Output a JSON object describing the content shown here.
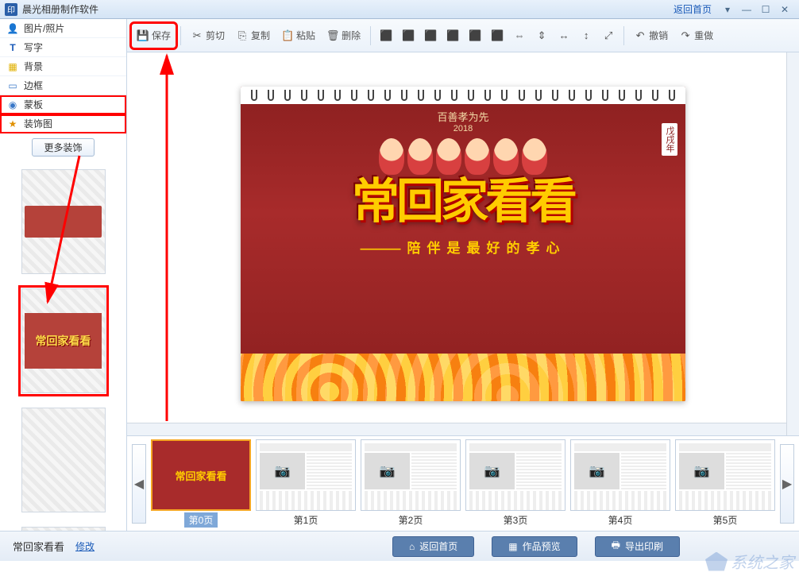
{
  "titlebar": {
    "app_name": "晨光相册制作软件",
    "home_link": "返回首页"
  },
  "sidebar": {
    "items": [
      {
        "label": "图片/照片",
        "icon": "👤",
        "color": "#3a78c8"
      },
      {
        "label": "写字",
        "icon": "T",
        "color": "#1a5ab8"
      },
      {
        "label": "背景",
        "icon": "▦",
        "color": "#e0b000"
      },
      {
        "label": "边框",
        "icon": "▭",
        "color": "#3a78c8"
      },
      {
        "label": "蒙板",
        "icon": "◉",
        "color": "#3a78c8"
      },
      {
        "label": "装饰图",
        "icon": "★",
        "color": "#e09000"
      }
    ],
    "more_label": "更多装饰"
  },
  "toolbar": {
    "save": "保存",
    "cut": "剪切",
    "copy": "复制",
    "paste": "粘贴",
    "delete": "删除",
    "undo": "撤销",
    "redo": "重做"
  },
  "canvas": {
    "top_text": "百善孝为先",
    "year": "2018",
    "side_text": "戊戌年",
    "main_title": "常回家看看",
    "subtitle_dash": "———",
    "subtitle": "陪伴是最好的孝心"
  },
  "pages": [
    {
      "label": "第0页"
    },
    {
      "label": "第1页"
    },
    {
      "label": "第2页"
    },
    {
      "label": "第3页"
    },
    {
      "label": "第4页"
    },
    {
      "label": "第5页"
    }
  ],
  "bottom": {
    "project_name": "常回家看看",
    "modify": "修改",
    "back_home": "返回首页",
    "preview": "作品预览",
    "export": "导出印刷"
  },
  "watermark": "系统之家"
}
